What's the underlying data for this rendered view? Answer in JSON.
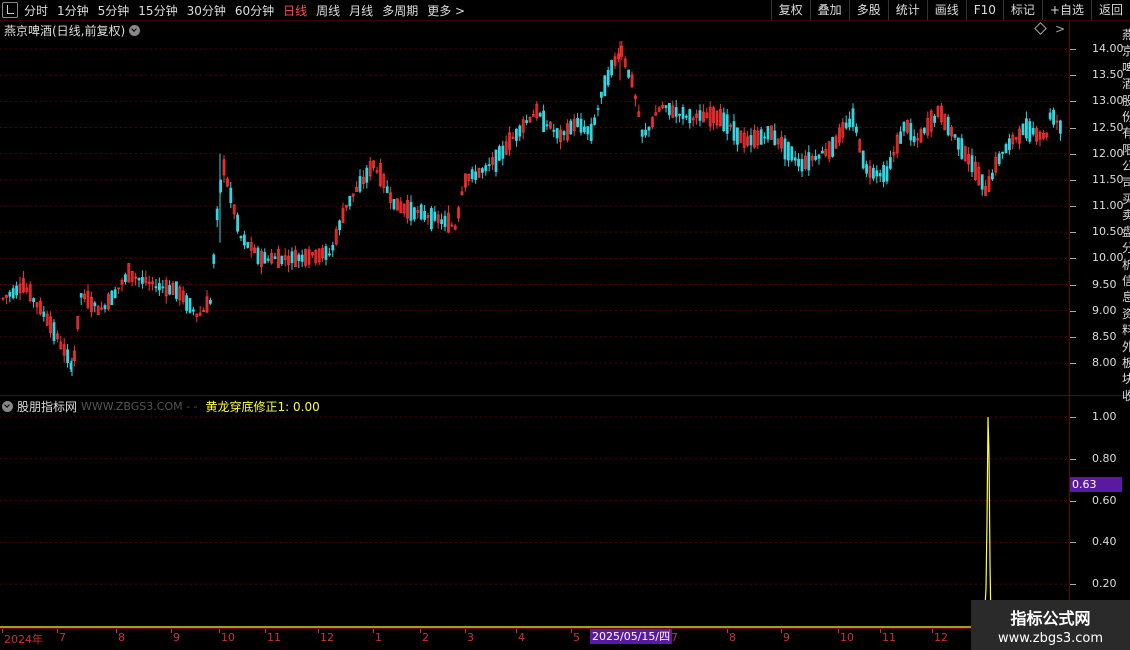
{
  "toolbar": {
    "left_items": [
      "分时",
      "1分钟",
      "5分钟",
      "15分钟",
      "30分钟",
      "60分钟",
      "日线",
      "周线",
      "月线",
      "多周期",
      "更多 >"
    ],
    "active_item": "日线",
    "right_items": [
      "复权",
      "叠加",
      "多股",
      "统计",
      "画线",
      "F10",
      "标记",
      "+自选",
      "返回"
    ]
  },
  "main_panel": {
    "title": "燕京啤酒(日线,前复权)"
  },
  "indicator_panel": {
    "name": "股朋指标网",
    "site": "WWW.ZBGS3.COM - -",
    "value_text": "黄龙穿底修正1: 0.00"
  },
  "price_axis": [
    "14.00",
    "13.50",
    "13.00",
    "12.50",
    "12.00",
    "11.50",
    "11.00",
    "10.50",
    "10.00",
    "9.50",
    "9.00",
    "8.50",
    "8.00"
  ],
  "indicator_axis": [
    "1.00",
    "0.80",
    "0.60",
    "0.40",
    "0.20"
  ],
  "indicator_price_tag": "0.63",
  "x_axis": {
    "labels": [
      "2024年",
      "7",
      "8",
      "9",
      "10",
      "11",
      "12",
      "1",
      "2",
      "3",
      "4",
      "5",
      "2025/05/15/四",
      "7",
      "8",
      "9",
      "10",
      "11",
      "12"
    ],
    "highlight": "2025/05/15/四"
  },
  "right_stub_text": [
    "燕",
    "京",
    "啤",
    "酒",
    "股",
    "份",
    "有",
    "限",
    "公",
    "司",
    "买",
    "卖",
    "盘",
    "分",
    "析",
    "信",
    "息",
    "资",
    "料",
    "外",
    "板",
    "块",
    "收"
  ],
  "watermark": {
    "line1": "指标公式网",
    "line2": "www.zbgs3.com"
  },
  "colors": {
    "up": "#ff3333",
    "down": "#33d6e0",
    "signal": "#ffff33",
    "grid": "#5a0000"
  },
  "chart_data": {
    "type": "candlestick",
    "y_range": [
      7.7,
      14.2
    ],
    "indicator_range": [
      0,
      1.0
    ],
    "spike": {
      "peak": 1.0,
      "shown_value": 0.63
    },
    "price_path": [
      [
        0,
        9.2
      ],
      [
        22,
        9.5
      ],
      [
        48,
        8.8
      ],
      [
        72,
        7.9
      ],
      [
        80,
        9.3
      ],
      [
        100,
        9.0
      ],
      [
        128,
        9.7
      ],
      [
        150,
        9.5
      ],
      [
        175,
        9.4
      ],
      [
        198,
        8.9
      ],
      [
        210,
        9.2
      ],
      [
        215,
        10.6
      ],
      [
        222,
        11.8
      ],
      [
        240,
        10.4
      ],
      [
        260,
        10.0
      ],
      [
        290,
        10.0
      ],
      [
        330,
        10.1
      ],
      [
        345,
        11.0
      ],
      [
        373,
        11.8
      ],
      [
        395,
        11.0
      ],
      [
        430,
        10.8
      ],
      [
        455,
        10.6
      ],
      [
        463,
        11.5
      ],
      [
        485,
        11.7
      ],
      [
        500,
        12.0
      ],
      [
        520,
        12.5
      ],
      [
        535,
        12.8
      ],
      [
        560,
        12.3
      ],
      [
        575,
        12.6
      ],
      [
        590,
        12.4
      ],
      [
        605,
        13.4
      ],
      [
        620,
        14.0
      ],
      [
        632,
        13.3
      ],
      [
        642,
        12.3
      ],
      [
        660,
        12.9
      ],
      [
        690,
        12.7
      ],
      [
        720,
        12.7
      ],
      [
        745,
        12.2
      ],
      [
        770,
        12.4
      ],
      [
        800,
        11.8
      ],
      [
        830,
        12.1
      ],
      [
        852,
        12.7
      ],
      [
        865,
        11.7
      ],
      [
        885,
        11.6
      ],
      [
        905,
        12.6
      ],
      [
        915,
        12.2
      ],
      [
        938,
        12.8
      ],
      [
        965,
        12.0
      ],
      [
        985,
        11.3
      ],
      [
        1000,
        12.0
      ],
      [
        1025,
        12.5
      ],
      [
        1045,
        12.3
      ],
      [
        1050,
        12.8
      ],
      [
        1060,
        12.5
      ]
    ]
  }
}
